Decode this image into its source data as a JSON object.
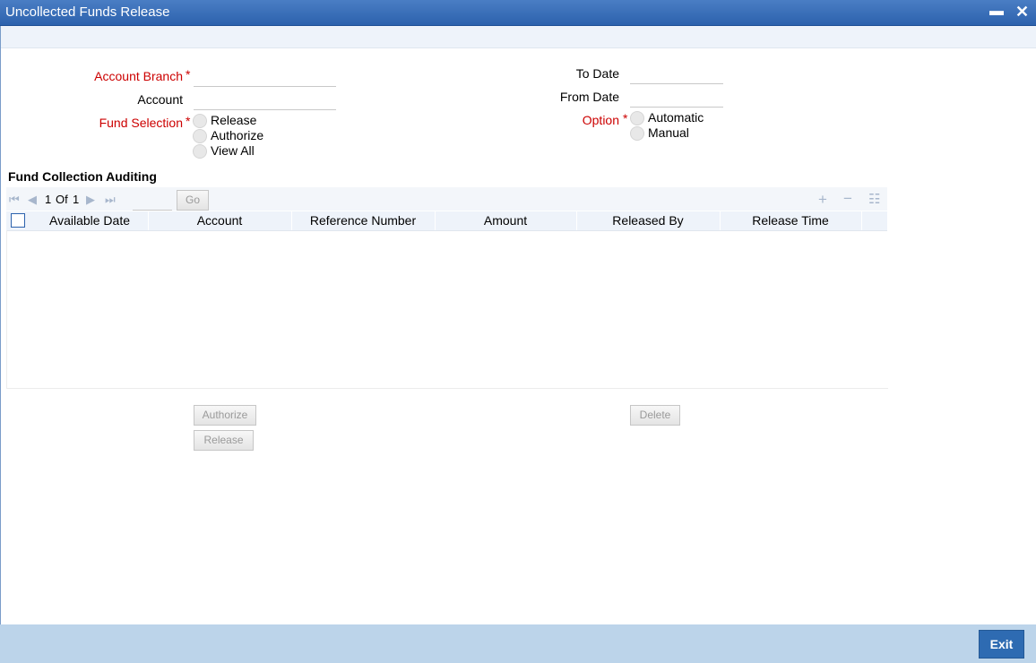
{
  "window": {
    "title": "Uncollected Funds Release",
    "minimize_icon": "minimize-icon",
    "close_icon": "close-icon"
  },
  "form": {
    "account_branch": {
      "label": "Account Branch",
      "required_mark": "*",
      "value": ""
    },
    "account": {
      "label": "Account",
      "value": ""
    },
    "fund_selection": {
      "label": "Fund Selection",
      "required_mark": "*",
      "options": [
        "Release",
        "Authorize",
        "View All"
      ]
    },
    "to_date": {
      "label": "To Date",
      "value": ""
    },
    "from_date": {
      "label": "From Date",
      "value": ""
    },
    "option": {
      "label": "Option",
      "required_mark": "*",
      "options": [
        "Automatic",
        "Manual"
      ]
    }
  },
  "auditing": {
    "title": "Fund Collection Auditing",
    "pager": {
      "current": "1",
      "of_label": "Of",
      "total": "1",
      "go_label": "Go",
      "page_input": ""
    },
    "columns": [
      "Available Date",
      "Account",
      "Reference Number",
      "Amount",
      "Released By",
      "Release Time"
    ],
    "rows": []
  },
  "buttons": {
    "authorize": "Authorize",
    "release": "Release",
    "delete": "Delete",
    "exit": "Exit"
  },
  "colors": {
    "titlebar": "#2c62ad",
    "required": "#cc0000",
    "footer": "#bcd4ea",
    "exit_button": "#2e6bb2"
  }
}
